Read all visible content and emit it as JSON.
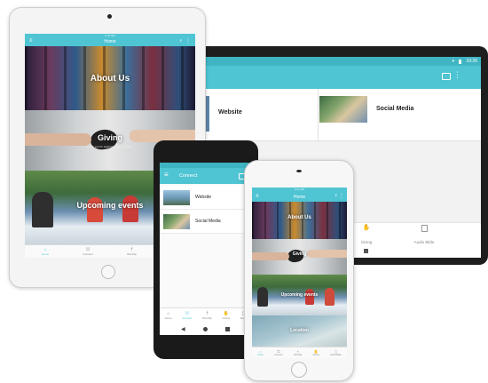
{
  "colors": {
    "accent": "#4fc4d3",
    "tablet_frame": "#1e1e1e",
    "phone_frame": "#1a1a1a"
  },
  "ipad": {
    "title": "Home",
    "status_time": "9:41 AM",
    "panels": {
      "about": "About Us",
      "giving": "Giving",
      "giving_sub": "Thank you for supporting our ministries!",
      "events": "Upcoming events"
    },
    "nav": [
      "Home",
      "Connect",
      "Worship",
      "Giving"
    ]
  },
  "android_tablet": {
    "status_time": "10:26",
    "items": [
      {
        "label": "Website"
      },
      {
        "label": "Social Media"
      }
    ],
    "nav": [
      "Giving",
      "Audio Bible"
    ]
  },
  "android_phone": {
    "title": "Connect",
    "items": [
      {
        "label": "Website"
      },
      {
        "label": "Social Media"
      }
    ],
    "nav": [
      "Home",
      "Connect",
      "Worship",
      "Giving",
      "Audio"
    ]
  },
  "iphone": {
    "title": "Home",
    "status_time": "9:41 AM",
    "panels": {
      "about": "About Us",
      "giving": "Giving",
      "events": "Upcoming events",
      "location": "Location"
    },
    "nav": [
      "Home",
      "Connect",
      "Worship",
      "Giving",
      "Audio Bible"
    ]
  }
}
